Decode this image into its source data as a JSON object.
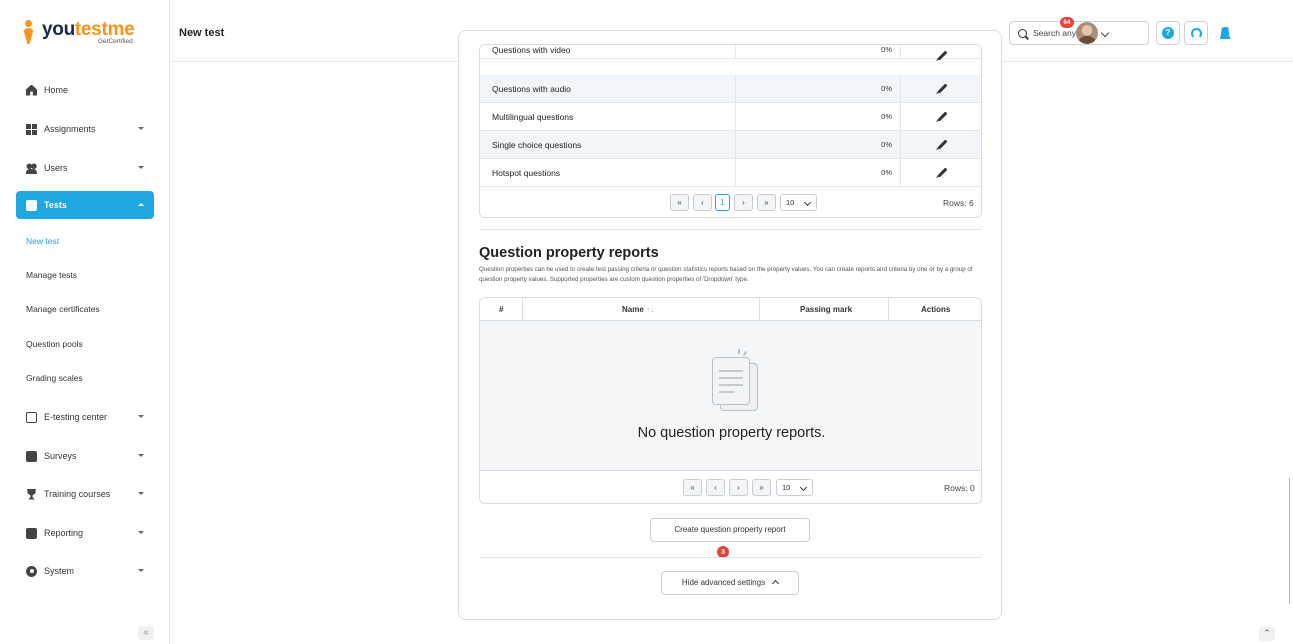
{
  "brand": {
    "name_part1": "you",
    "name_part2": "testme",
    "tagline": "GetCertified"
  },
  "sidebar": {
    "items": [
      {
        "label": "Home",
        "icon": "home-icon"
      },
      {
        "label": "Assignments",
        "icon": "grid-icon"
      },
      {
        "label": "Users",
        "icon": "users-icon"
      },
      {
        "label": "Tests",
        "icon": "tests-icon",
        "active": true
      },
      {
        "label": "E-testing center",
        "icon": "calendar-icon"
      },
      {
        "label": "Surveys",
        "icon": "survey-icon"
      },
      {
        "label": "Training courses",
        "icon": "trophy-icon"
      },
      {
        "label": "Reporting",
        "icon": "report-icon"
      },
      {
        "label": "System",
        "icon": "gear-icon"
      }
    ],
    "subitems": [
      "New test",
      "Manage tests",
      "Manage certificates",
      "Question pools",
      "Grading scales"
    ],
    "collapse_glyph": "«"
  },
  "header": {
    "title": "New test",
    "search_placeholder": "Search anything",
    "notification_count": "64",
    "help_glyph": "?"
  },
  "question_types_table": {
    "rows": [
      {
        "name": "Questions with video",
        "pct": "0%"
      },
      {
        "name": "Questions with audio",
        "pct": "0%"
      },
      {
        "name": "Multilingual questions",
        "pct": "0%"
      },
      {
        "name": "Single choice questions",
        "pct": "0%"
      },
      {
        "name": "Hotspot questions",
        "pct": "0%"
      }
    ],
    "pager": {
      "first": "«",
      "prev": "‹",
      "page": "1",
      "next": "›",
      "last": "»",
      "page_size": "10",
      "rows_label": "Rows: 6"
    }
  },
  "property_reports": {
    "title": "Question property reports",
    "description": "Question properties can be used to create test passing criteria or question statistics reports based on the property values. You can create reports and criteria by one or by a group of question property values. Supported properties are custom question properties of 'Dropdown' type.",
    "columns": {
      "num": "#",
      "name": "Name",
      "sort": "↑↓",
      "passing": "Passing mark",
      "actions": "Actions"
    },
    "empty_text": "No question property reports.",
    "pager": {
      "first": "«",
      "prev": "‹",
      "next": "›",
      "last": "»",
      "page_size": "10",
      "rows_label": "Rows: 0"
    },
    "create_button": "Create question property report",
    "step_marker": "3"
  },
  "hide_advanced_button": "Hide advanced settings",
  "scroll_top_glyph": "⌃",
  "colors": {
    "accent": "#1ea7e0",
    "brand_orange": "#f7941d",
    "badge_red": "#e8453c"
  }
}
